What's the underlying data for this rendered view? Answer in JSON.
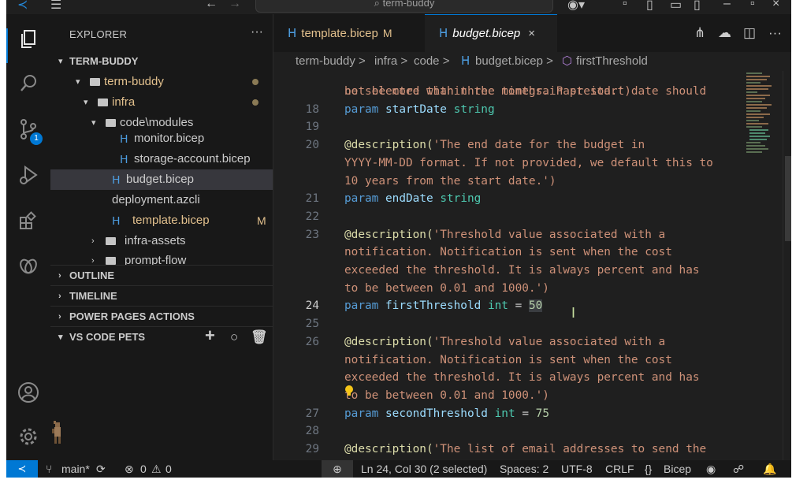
{
  "titlebar": {
    "search": "term-buddy"
  },
  "activity": {
    "badge": "1"
  },
  "sidebar": {
    "header": "EXPLORER",
    "more": "···",
    "root": "TERM-BUDDY",
    "tree": [
      {
        "label": "term-buddy"
      },
      {
        "label": "infra"
      },
      {
        "label": "code\\modules"
      },
      {
        "label": "monitor.bicep"
      },
      {
        "label": "storage-account.bicep"
      },
      {
        "label": "budget.bicep"
      },
      {
        "label": "deployment.azcli"
      },
      {
        "label": "template.bicep",
        "flag": "M"
      },
      {
        "label": "infra-assets"
      },
      {
        "label": "prompt-flow"
      }
    ],
    "sections": {
      "outline": "OUTLINE",
      "timeline": "TIMELINE",
      "powerpages": "POWER PAGES ACTIONS",
      "pets": "VS CODE PETS"
    },
    "pet_tools": {
      "add": "+",
      "ball": "○",
      "delete": "🗑"
    }
  },
  "tabs": [
    {
      "label": "template.bicep",
      "flag": "M"
    },
    {
      "label": "budget.bicep",
      "close": "×"
    }
  ],
  "breadcrumb": {
    "items": [
      "term-buddy",
      "infra",
      "code",
      "budget.bicep",
      "firstThreshold"
    ],
    "sep": ">"
  },
  "editor": {
    "partial_top": "not be more than three months. Past start date should",
    "lines": [
      {
        "n": "",
        "cont": "be selected within the timegrain preiod.')"
      },
      {
        "n": "18",
        "kw": "param",
        "name": "startDate",
        "type": "string"
      },
      {
        "n": "19"
      },
      {
        "n": "20",
        "dec": "@description(",
        "str": "'The end date for the budget in"
      },
      {
        "n": "",
        "cont": "YYYY-MM-DD format. If not provided, we default this to"
      },
      {
        "n": "",
        "cont": "10 years from the start date.')"
      },
      {
        "n": "21",
        "kw": "param",
        "name": "endDate",
        "type": "string"
      },
      {
        "n": "22"
      },
      {
        "n": "23",
        "dec": "@description(",
        "str": "'Threshold value associated with a"
      },
      {
        "n": "",
        "cont": "notification. Notification is sent when the cost"
      },
      {
        "n": "",
        "cont": "exceeded the threshold. It is always percent and has"
      },
      {
        "n": "",
        "cont": "to be between 0.01 and 1000.')"
      },
      {
        "n": "24",
        "kw": "param",
        "name": "firstThreshold",
        "type": "int",
        "op": "=",
        "val": "50"
      },
      {
        "n": "25"
      },
      {
        "n": "26",
        "dec": "@description(",
        "str": "'Threshold value associated with a"
      },
      {
        "n": "",
        "cont": "notification. Notification is sent when the cost"
      },
      {
        "n": "",
        "cont": "exceeded the threshold. It is always percent and has"
      },
      {
        "n": "",
        "cont": "to be between 0.01 and 1000.')"
      },
      {
        "n": "27",
        "kw": "param",
        "name": "secondThreshold",
        "type": "int",
        "op": "=",
        "val": "75"
      },
      {
        "n": "28"
      },
      {
        "n": "29",
        "dec": "@description(",
        "str": "'The list of email addresses to send the"
      }
    ]
  },
  "status": {
    "branch": "main*",
    "errors": "0",
    "warnings": "0",
    "position": "Ln 24, Col 30 (2 selected)",
    "spaces": "Spaces: 2",
    "encoding": "UTF-8",
    "eol": "CRLF",
    "language": "Bicep"
  },
  "colors": {
    "accent": "#0078d4",
    "modified": "#e2c08d",
    "string": "#ce9178",
    "keyword": "#569cd6"
  }
}
